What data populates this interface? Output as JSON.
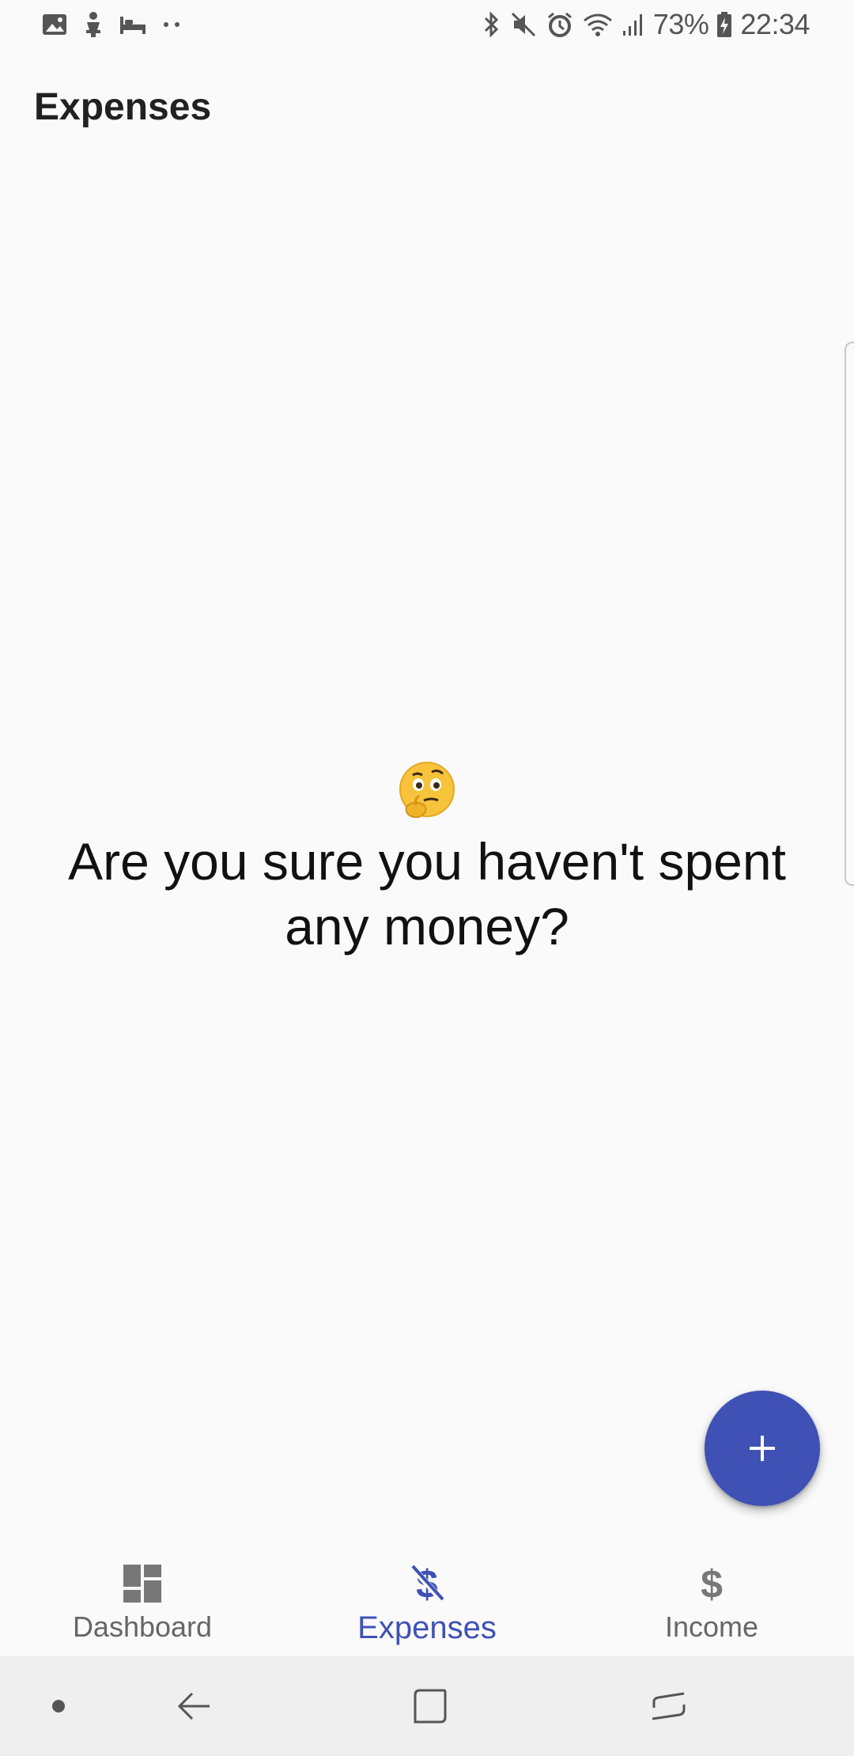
{
  "status_bar": {
    "battery": "73%",
    "time": "22:34",
    "left_icons": [
      "image-icon",
      "person-icon",
      "bed-icon",
      "more-dots-icon"
    ],
    "right_icons": [
      "bluetooth-icon",
      "mute-icon",
      "alarm-icon",
      "wifi-icon",
      "signal-icon",
      "battery-charging-icon"
    ]
  },
  "app_bar": {
    "title": "Expenses"
  },
  "empty_state": {
    "emoji": "thinking-face",
    "message": "Are you sure you haven't spent any money?"
  },
  "fab": {
    "icon": "plus-icon",
    "color": "#3f51b5"
  },
  "bottom_nav": {
    "items": [
      {
        "label": "Dashboard",
        "icon": "dashboard-icon",
        "active": false
      },
      {
        "label": "Expenses",
        "icon": "money-off-icon",
        "active": true
      },
      {
        "label": "Income",
        "icon": "dollar-icon",
        "active": false
      }
    ],
    "active_color": "#3f51b5",
    "inactive_color": "#666666"
  },
  "system_nav": {
    "buttons": [
      "dot-icon",
      "back-icon",
      "home-icon",
      "recents-icon"
    ]
  }
}
